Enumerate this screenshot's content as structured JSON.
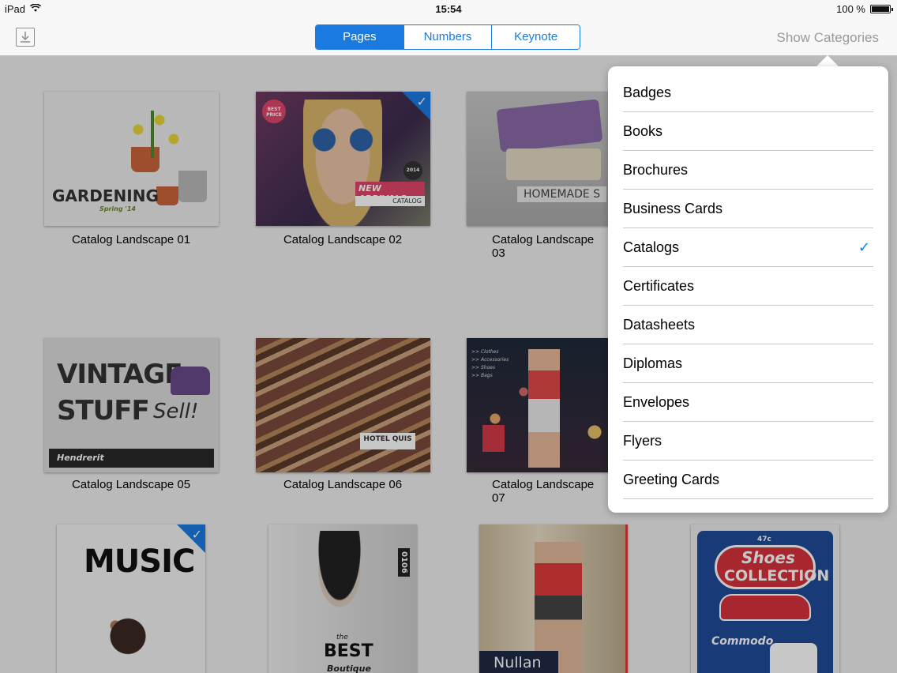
{
  "statusbar": {
    "device": "iPad",
    "time": "15:54",
    "battery": "100 %"
  },
  "toolbar": {
    "segments": [
      "Pages",
      "Numbers",
      "Keynote"
    ],
    "active_segment": "Pages",
    "show_categories": "Show Categories"
  },
  "templates": [
    {
      "caption": "Catalog Landscape 01",
      "art": "GARDENING",
      "art_sub": "Spring '14"
    },
    {
      "caption": "Catalog Landscape 02",
      "art": "NEW ARRIVALS",
      "art_sub": "CATALOG",
      "badge": "BEST PRICE",
      "year": "2014",
      "selected": true
    },
    {
      "caption": "Catalog Landscape 03",
      "art": "HOMEMADE S"
    },
    {
      "caption": "Catalog Landscape 05",
      "art": "VINTAGE",
      "art2": "STUFF",
      "art3": "Sell!",
      "art_sub": "Hendrerit"
    },
    {
      "caption": "Catalog Landscape 06",
      "art": "HOTEL QUIS"
    },
    {
      "caption": "Catalog Landscape 07",
      "art": ">> Clothes",
      "art2": ">> Accessories",
      "art3": ">> Shoes",
      "art4": ">> Bags"
    },
    {
      "art": "MUSIC",
      "selected": true
    },
    {
      "art": "BEST",
      "art_sub": "Boutique",
      "art_top": "the",
      "side": "0106"
    },
    {
      "art": "Nullan"
    },
    {
      "art": "Shoes",
      "art2": "COLLECTION",
      "art_sub": "Commodo",
      "price": "47c"
    }
  ],
  "categories": {
    "items": [
      "Badges",
      "Books",
      "Brochures",
      "Business Cards",
      "Catalogs",
      "Certificates",
      "Datasheets",
      "Diplomas",
      "Envelopes",
      "Flyers",
      "Greeting Cards"
    ],
    "selected": "Catalogs"
  },
  "colors": {
    "accent": "#1a7ae0"
  }
}
